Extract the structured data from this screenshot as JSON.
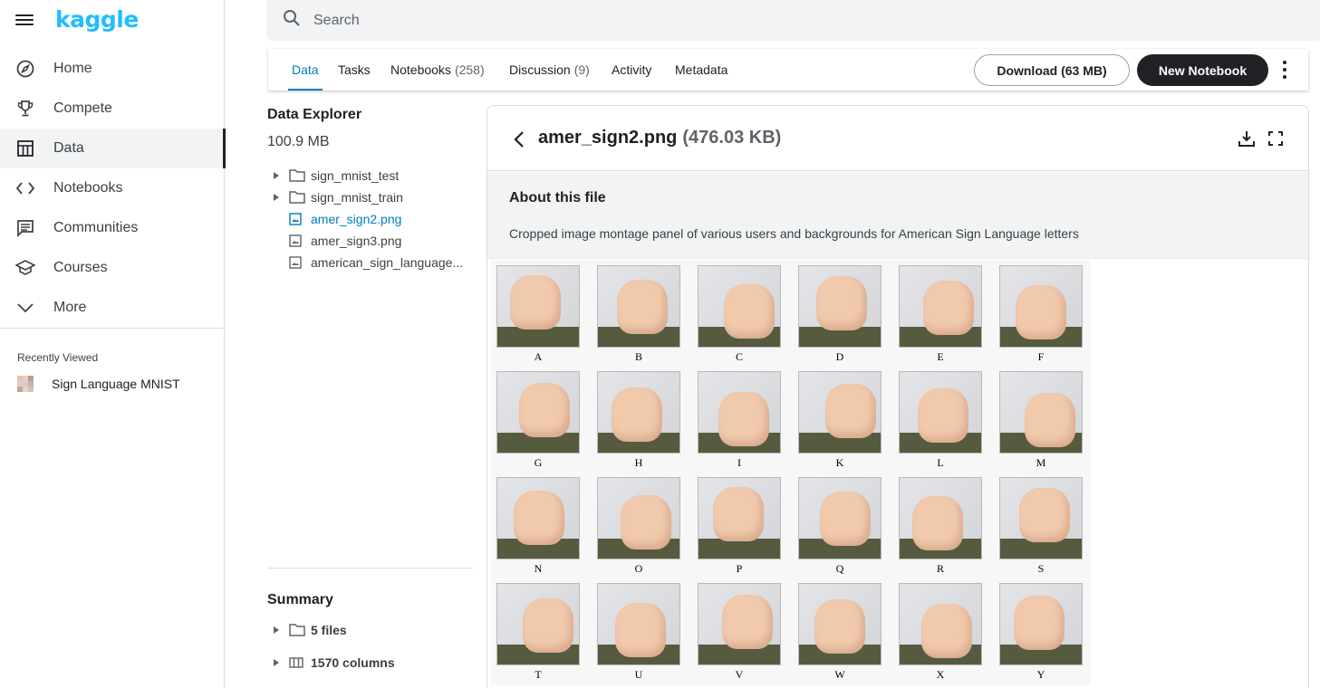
{
  "app": {
    "logo": "kaggle"
  },
  "sidebar": {
    "items": [
      {
        "label": "Home",
        "icon": "compass-icon"
      },
      {
        "label": "Compete",
        "icon": "trophy-icon"
      },
      {
        "label": "Data",
        "icon": "table-icon",
        "active": true
      },
      {
        "label": "Notebooks",
        "icon": "code-icon"
      },
      {
        "label": "Communities",
        "icon": "comments-icon"
      },
      {
        "label": "Courses",
        "icon": "school-icon"
      },
      {
        "label": "More",
        "icon": "chevron-down-icon"
      }
    ],
    "recently_viewed_title": "Recently Viewed",
    "recent": [
      {
        "label": "Sign Language MNIST"
      }
    ]
  },
  "search": {
    "placeholder": "Search"
  },
  "tabs": {
    "items": [
      {
        "label": "Data",
        "count": "",
        "active": true
      },
      {
        "label": "Tasks",
        "count": ""
      },
      {
        "label": "Notebooks",
        "count": "(258)"
      },
      {
        "label": "Discussion",
        "count": "(9)"
      },
      {
        "label": "Activity",
        "count": ""
      },
      {
        "label": "Metadata",
        "count": ""
      }
    ],
    "download_label": "Download (63 MB)",
    "new_notebook_label": "New Notebook"
  },
  "explorer": {
    "title": "Data Explorer",
    "size": "100.9 MB",
    "files": [
      {
        "name": "sign_mnist_test",
        "type": "folder"
      },
      {
        "name": "sign_mnist_train",
        "type": "folder"
      },
      {
        "name": "amer_sign2.png",
        "type": "image",
        "selected": true
      },
      {
        "name": "amer_sign3.png",
        "type": "image"
      },
      {
        "name": "american_sign_language...",
        "type": "image"
      }
    ]
  },
  "summary": {
    "title": "Summary",
    "files_label": "5 files",
    "columns_label": "1570 columns"
  },
  "file_panel": {
    "filename": "amer_sign2.png",
    "filesize": "(476.03 KB)",
    "about_title": "About this file",
    "description": "Cropped image montage panel of various users and backgrounds for American Sign Language letters",
    "letters": [
      "A",
      "B",
      "C",
      "D",
      "E",
      "F",
      "G",
      "H",
      "I",
      "K",
      "L",
      "M",
      "N",
      "O",
      "P",
      "Q",
      "R",
      "S",
      "T",
      "U",
      "V",
      "W",
      "X",
      "Y"
    ]
  },
  "colors": {
    "brand": "#20beff",
    "accent": "#007bbd",
    "dark_button": "#202124"
  }
}
